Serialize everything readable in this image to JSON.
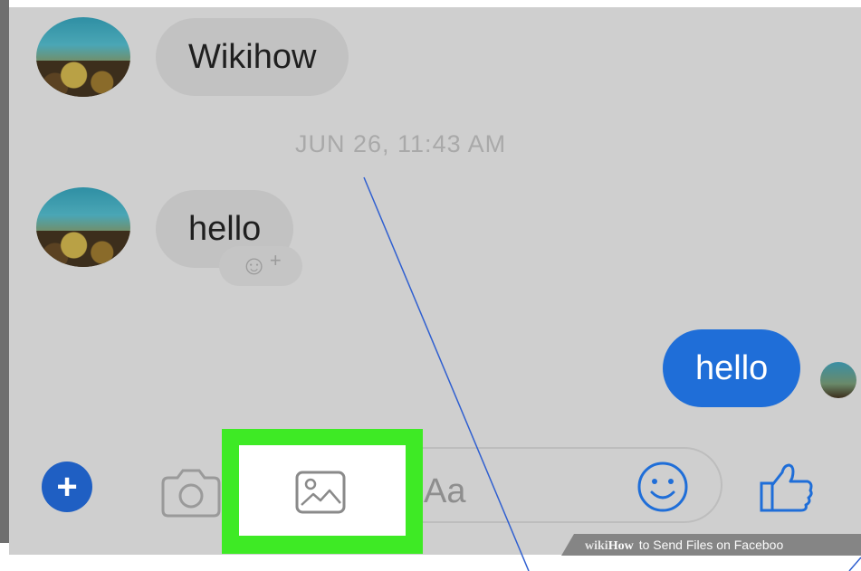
{
  "conversation": {
    "messages": [
      {
        "direction": "incoming",
        "text": "Wikihow"
      },
      {
        "direction": "incoming",
        "text": "hello"
      },
      {
        "direction": "outgoing",
        "text": "hello"
      }
    ],
    "timestamp": "JUN 26, 11:43 AM",
    "reaction_symbol": "☺",
    "reaction_plus": "+"
  },
  "composer": {
    "placeholder": "Aa",
    "icons": [
      "plus-icon",
      "camera-icon",
      "gallery-icon",
      "emoji-icon",
      "thumbs-up-icon"
    ]
  },
  "watermark": {
    "wiki": "wiki",
    "how": "How",
    "rest": "to Send Files on Faceboo"
  },
  "colors": {
    "screen_background": "#cfcfcf",
    "incoming_bubble": "#c2c2c2",
    "outgoing_bubble": "#1f6ed8",
    "highlight": "#3eea25",
    "pointer_line": "#2f5fd0"
  }
}
